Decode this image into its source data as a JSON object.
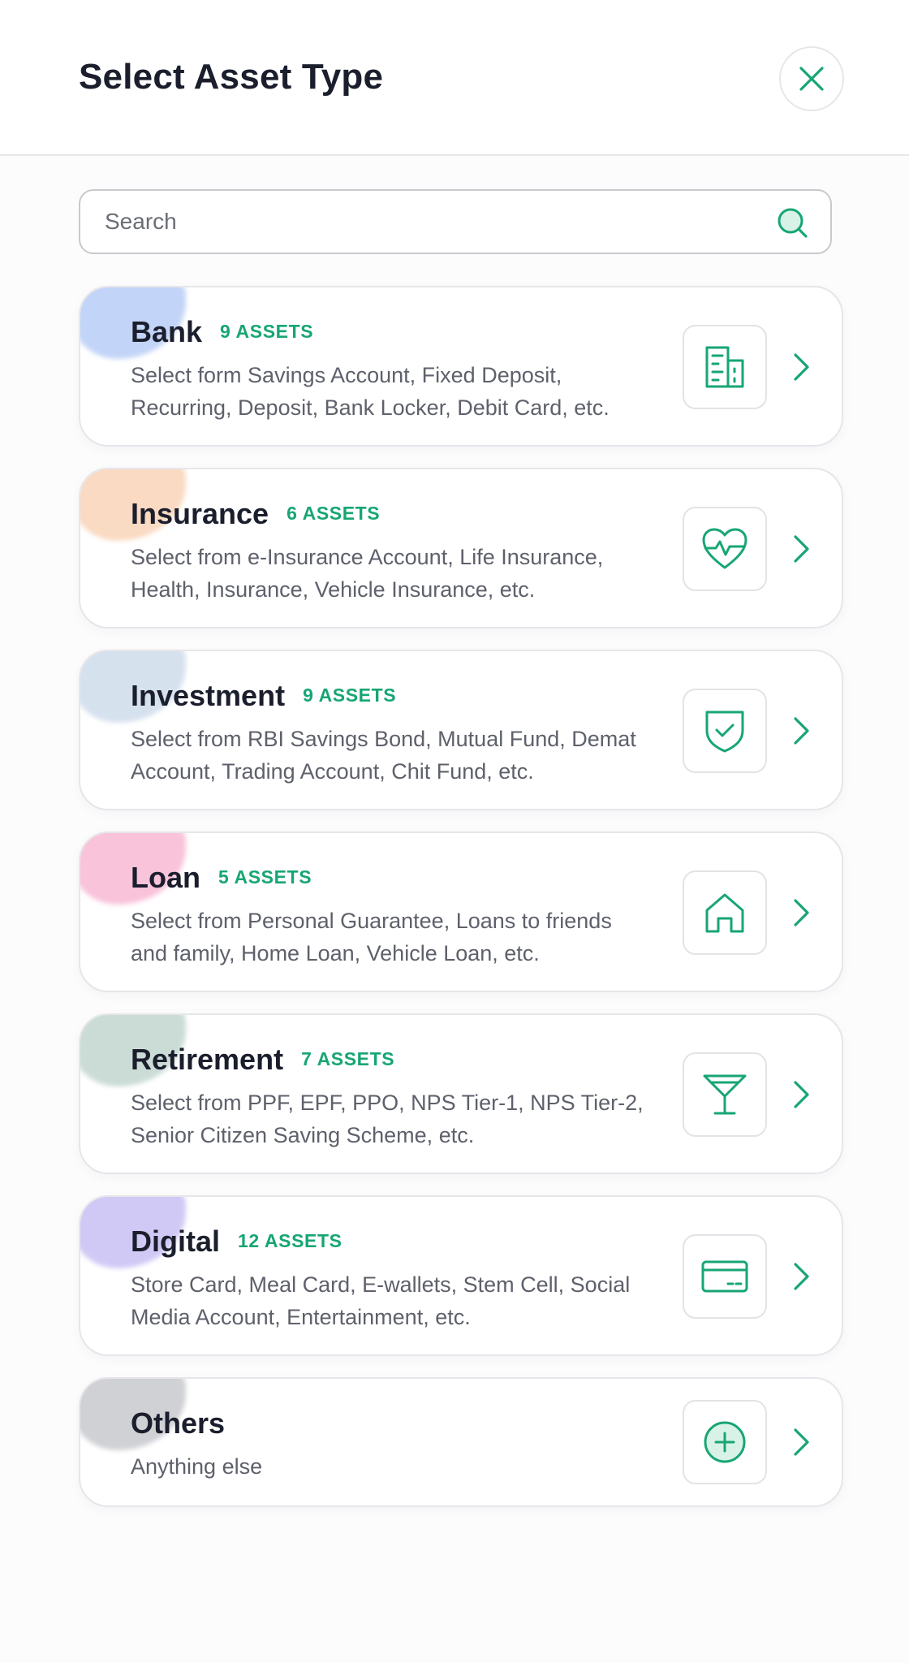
{
  "header": {
    "title": "Select Asset Type",
    "close_icon": "close-icon"
  },
  "search": {
    "placeholder": "Search",
    "value": "",
    "icon": "search-icon"
  },
  "colors": {
    "accent": "#17a673",
    "title": "#1b1e2c",
    "muted": "#5e616b"
  },
  "categories": [
    {
      "title": "Bank",
      "badge": "9 ASSETS",
      "description": "Select form Savings Account, Fixed Deposit, Recurring, Deposit, Bank Locker, Debit Card, etc.",
      "icon": "building-icon",
      "blob_color": "#b8cdf6"
    },
    {
      "title": "Insurance",
      "badge": "6 ASSETS",
      "description": "Select from e-Insurance Account, Life Insurance, Health, Insurance, Vehicle Insurance, etc.",
      "icon": "heart-pulse-icon",
      "blob_color": "#f9d4b8"
    },
    {
      "title": "Investment",
      "badge": "9 ASSETS",
      "description": "Select from RBI Savings Bond, Mutual Fund, Demat Account, Trading Account, Chit Fund, etc.",
      "icon": "shield-check-icon",
      "blob_color": "#cfdcec"
    },
    {
      "title": "Loan",
      "badge": "5 ASSETS",
      "description": "Select from Personal Guarantee, Loans to friends and family, Home Loan, Vehicle Loan, etc.",
      "icon": "home-icon",
      "blob_color": "#f8b9d4"
    },
    {
      "title": "Retirement",
      "badge": "7 ASSETS",
      "description": "Select from PPF, EPF, PPO, NPS Tier-1, NPS Tier-2, Senior Citizen Saving Scheme, etc.",
      "icon": "cocktail-glass-icon",
      "blob_color": "#c2d6cf"
    },
    {
      "title": "Digital",
      "badge": "12 ASSETS",
      "description": "Store Card, Meal Card, E-wallets, Stem Cell, Social Media Account, Entertainment, etc.",
      "icon": "credit-card-icon",
      "blob_color": "#c9c0f4"
    },
    {
      "title": "Others",
      "badge": "",
      "description": "Anything else",
      "icon": "plus-circle-icon",
      "blob_color": "#c8c9ce"
    }
  ]
}
